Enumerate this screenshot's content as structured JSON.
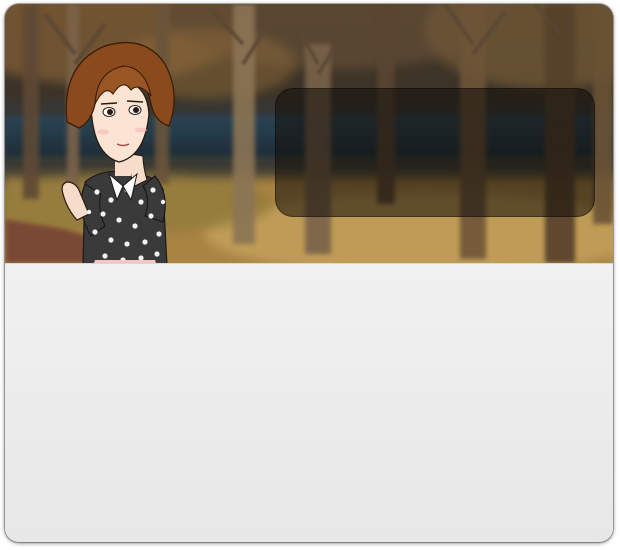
{
  "dialog": {
    "speech_text": "",
    "content_text": ""
  },
  "colors": {
    "panel_background": "#ececec",
    "speech_box_background": "rgba(18,14,10,0.55)",
    "forest_bark": "#6b5236",
    "forest_grass": "#b08a45",
    "path_color": "#7a4a34"
  },
  "icons": {
    "character": "girl-avatar-icon"
  }
}
